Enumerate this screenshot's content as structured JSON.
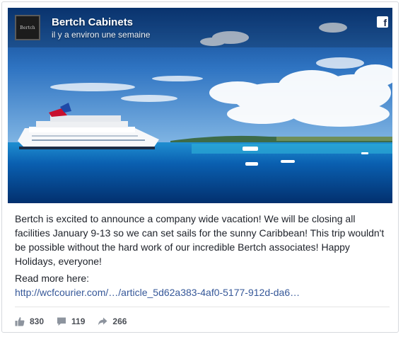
{
  "post": {
    "page_name": "Bertch Cabinets",
    "avatar_text": "Bertch",
    "time": "il y a environ une semaine",
    "network_icon": "facebook-icon",
    "text": "Bertch is excited to announce a company wide vacation! We will be closing all facilities January 9-13 so we can set sails for the sunny Caribbean! This trip wouldn't be possible without the hard work of our incredible Bertch associates! Happy Holidays, everyone!",
    "read_more": "Read more here:",
    "link": "http://wcfcourier.com/…/article_5d62a383-4af0-5177-912d-da6…"
  },
  "stats": {
    "likes": "830",
    "comments": "119",
    "shares": "266"
  },
  "colors": {
    "link": "#365899",
    "text": "#1d2129",
    "stat": "#4b4f56",
    "sea": "#0a5fb0"
  }
}
